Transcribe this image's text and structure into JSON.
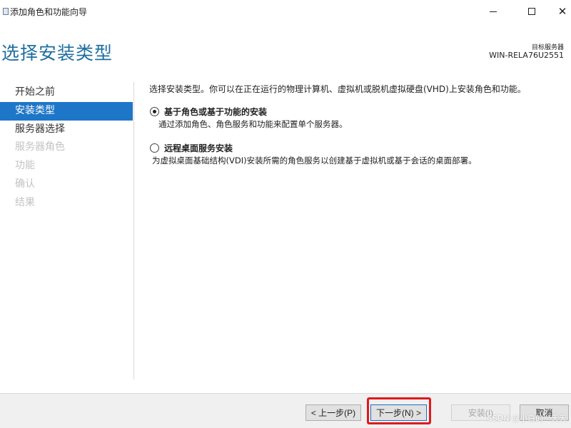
{
  "window": {
    "title": "添加角色和功能向导",
    "minimize_icon": "minimize-icon",
    "maximize_icon": "maximize-icon",
    "close_icon": "close-icon"
  },
  "header": {
    "page_title": "选择安装类型",
    "target_server_label": "目标服务器",
    "target_server_name": "WIN-RELA76U2551"
  },
  "nav": {
    "items": [
      {
        "label": "开始之前",
        "state": "normal"
      },
      {
        "label": "安装类型",
        "state": "active"
      },
      {
        "label": "服务器选择",
        "state": "normal"
      },
      {
        "label": "服务器角色",
        "state": "disabled"
      },
      {
        "label": "功能",
        "state": "disabled"
      },
      {
        "label": "确认",
        "state": "disabled"
      },
      {
        "label": "结果",
        "state": "disabled"
      }
    ]
  },
  "main": {
    "intro": "选择安装类型。你可以在正在运行的物理计算机、虚拟机或脱机虚拟硬盘(VHD)上安装角色和功能。",
    "options": [
      {
        "title": "基于角色或基于功能的安装",
        "description": "通过添加角色、角色服务和功能来配置单个服务器。",
        "selected": true
      },
      {
        "title": "远程桌面服务安装",
        "description": "为虚拟桌面基础结构(VDI)安装所需的角色服务以创建基于虚拟机或基于会话的桌面部署。",
        "selected": false
      }
    ]
  },
  "footer": {
    "prev_label": "< 上一步(P)",
    "next_label": "下一步(N) >",
    "install_label": "安装(I)",
    "cancel_label": "取消"
  },
  "watermark": "CSDN @小白的一天天",
  "colors": {
    "accent": "#1e76c8",
    "heading": "#1e6ea0",
    "highlight_box": "#e0191d"
  }
}
